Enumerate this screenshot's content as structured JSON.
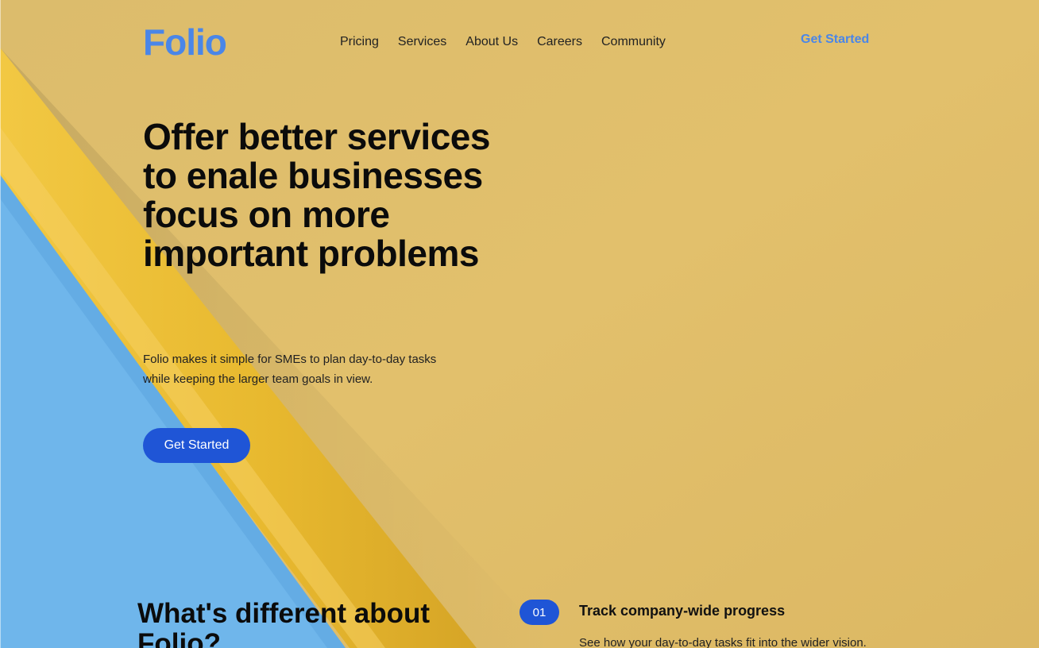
{
  "brand": {
    "logo": "Folio",
    "color": "#4a86e8"
  },
  "nav": {
    "items": [
      {
        "label": "Pricing"
      },
      {
        "label": "Services"
      },
      {
        "label": "About Us"
      },
      {
        "label": "Careers"
      },
      {
        "label": "Community"
      }
    ],
    "cta_label": "Get Started"
  },
  "hero": {
    "title": "Offer better services to enale businesses focus on more important problems",
    "subtitle": "Folio makes it simple for SMEs to plan day-to-day tasks while keeping the larger team goals in view.",
    "button_label": "Get Started",
    "button_color": "#1f55d6"
  },
  "features": {
    "heading": "What's different about Folio?",
    "items": [
      {
        "number": "01",
        "title": "Track company-wide progress",
        "description": "See how your day-to-day tasks fit into the wider vision."
      }
    ]
  },
  "colors": {
    "background_yellow": "#e0bf6b",
    "pencil_yellow": "#edc13a",
    "paper_blue": "#6fb6eb",
    "accent_blue": "#1f55d6"
  }
}
